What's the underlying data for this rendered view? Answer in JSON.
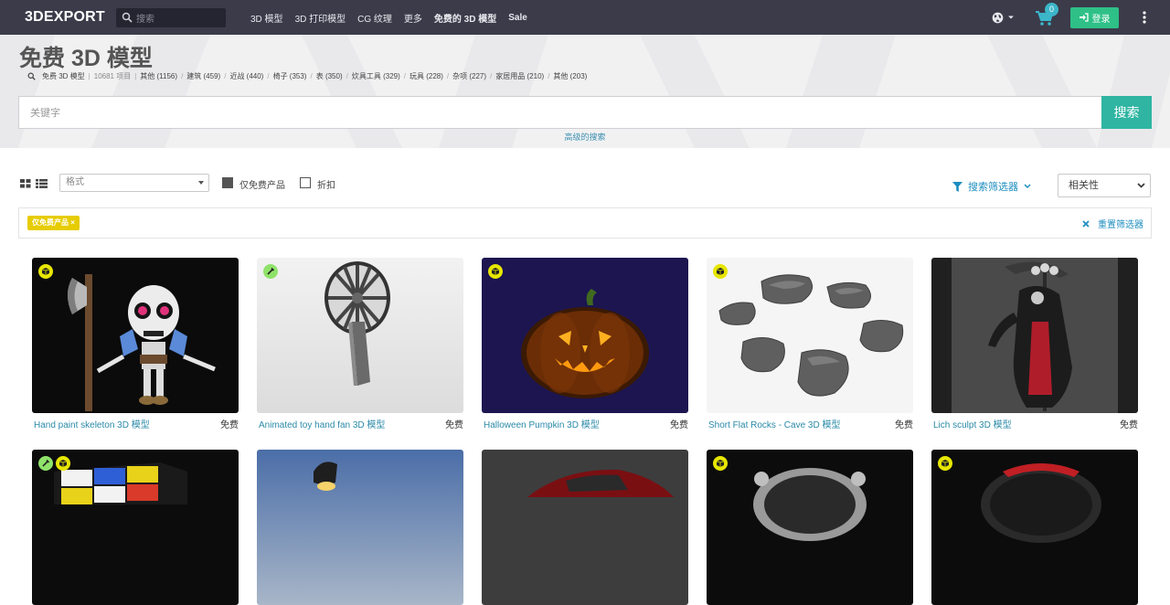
{
  "navbar": {
    "logo": "3DEXPORT",
    "search_placeholder": "搜索",
    "links": [
      "3D 模型",
      "3D 打印模型",
      "CG 纹理",
      "更多",
      "免费的 3D 模型",
      "Sale"
    ],
    "cart_count": "0",
    "login_label": "登录"
  },
  "hero": {
    "title": "免费 3D 模型",
    "breadcrumb_root": "免费 3D 模型",
    "item_count": "10681 项目",
    "categories": [
      "其他 (1156)",
      "建筑 (459)",
      "近战 (440)",
      "椅子 (353)",
      "表 (350)",
      "炊具工具 (329)",
      "玩具 (228)",
      "杂项 (227)",
      "家居用品 (210)",
      "其他 (203)"
    ],
    "search_placeholder": "关键字",
    "search_button": "搜索",
    "advanced_search": "高级的搜索"
  },
  "toolbar": {
    "format_placeholder": "格式",
    "free_only_label": "仅免费产品",
    "discount_label": "折扣",
    "filter_toggle": "搜索筛选器",
    "sort_value": "相关性"
  },
  "active_filters": {
    "tag_label": "仅免费产品 ×",
    "reset_label": "重置筛选器"
  },
  "products": [
    {
      "title": "Hand paint skeleton 3D 模型",
      "price": "免费"
    },
    {
      "title": "Animated toy hand fan 3D 模型",
      "price": "免费"
    },
    {
      "title": "Halloween Pumpkin 3D 模型",
      "price": "免费"
    },
    {
      "title": "Short Flat Rocks - Cave 3D 模型",
      "price": "免费"
    },
    {
      "title": "Lich sculpt 3D 模型",
      "price": "免费"
    }
  ],
  "colors": {
    "navbar_bg": "#3b3b4a",
    "accent_green": "#2ec087",
    "search_btn": "#2fb5a2",
    "link_blue": "#1d8ec0",
    "tag_yellow": "#e6cc00"
  }
}
